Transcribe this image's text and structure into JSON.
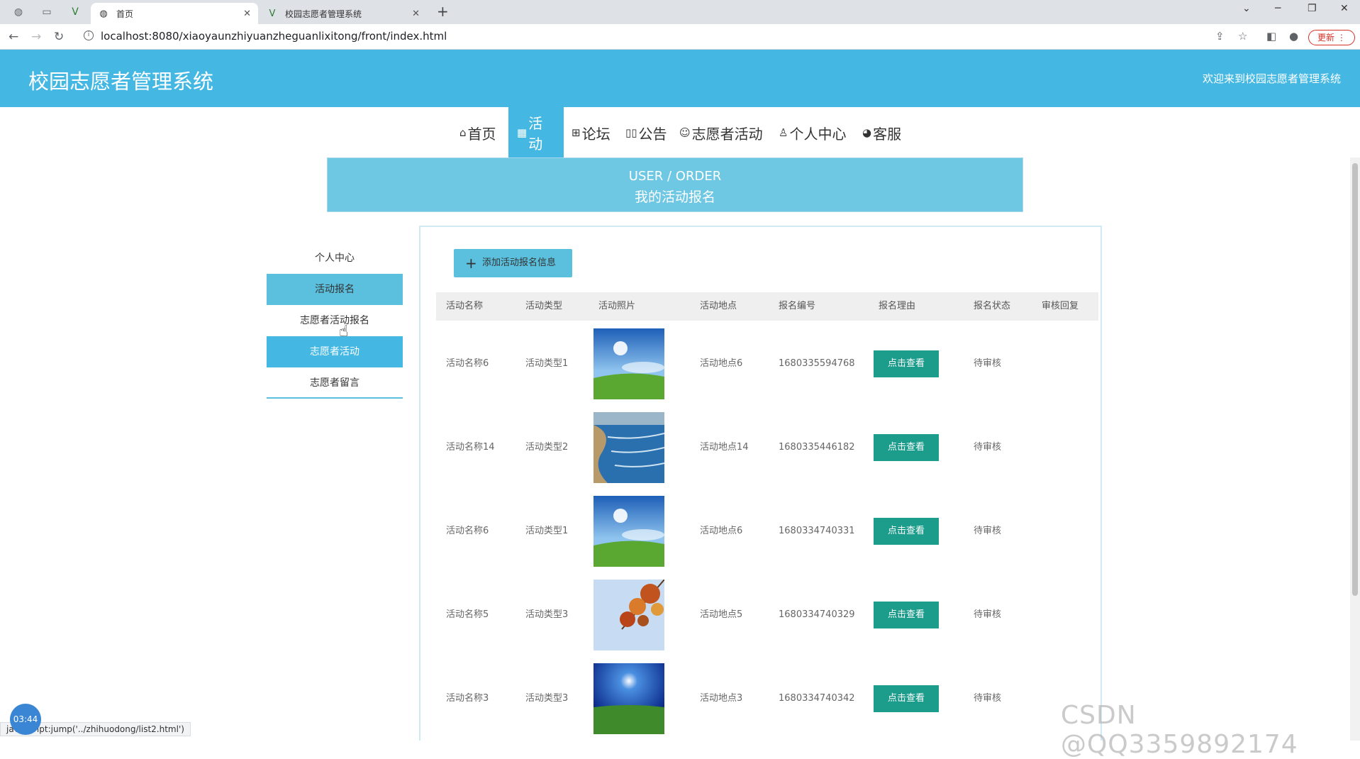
{
  "browser": {
    "tabs": [
      {
        "title": "首页",
        "active": true
      },
      {
        "title": "校园志愿者管理系统",
        "active": false
      }
    ],
    "url": "localhost:8080/xiaoyaunzhiyuanzheguanlixitong/front/index.html",
    "update_label": "更新",
    "status_text": "javascript:jump('../zhihuodong/list2.html')"
  },
  "header": {
    "title": "校园志愿者管理系统",
    "welcome": "欢迎来到校园志愿者管理系统"
  },
  "menu": [
    {
      "label": "首页",
      "icon": "home-icon"
    },
    {
      "label": "活动",
      "icon": "activity-icon"
    },
    {
      "label": "论坛",
      "icon": "forum-icon"
    },
    {
      "label": "公告",
      "icon": "notice-icon"
    },
    {
      "label": "志愿者活动",
      "icon": "volunteer-icon"
    },
    {
      "label": "个人中心",
      "icon": "user-icon"
    },
    {
      "label": "客服",
      "icon": "service-icon"
    }
  ],
  "banner": {
    "en": "USER / ORDER",
    "cn": "我的活动报名"
  },
  "sidebar": [
    {
      "label": "个人中心"
    },
    {
      "label": "活动报名"
    },
    {
      "label": "志愿者活动报名"
    },
    {
      "label": "志愿者活动"
    },
    {
      "label": "志愿者留言"
    }
  ],
  "add_button": "添加活动报名信息",
  "table": {
    "headers": [
      "活动名称",
      "活动类型",
      "活动照片",
      "活动地点",
      "报名编号",
      "报名理由",
      "报名状态",
      "审核回复"
    ],
    "view_label": "点击查看",
    "rows": [
      {
        "name": "活动名称6",
        "type": "活动类型1",
        "photo": "grass-sky",
        "place": "活动地点6",
        "code": "1680335594768",
        "status": "待审核"
      },
      {
        "name": "活动名称14",
        "type": "活动类型2",
        "photo": "coast",
        "place": "活动地点14",
        "code": "1680335446182",
        "status": "待审核"
      },
      {
        "name": "活动名称6",
        "type": "活动类型1",
        "photo": "grass-sky",
        "place": "活动地点6",
        "code": "1680334740331",
        "status": "待审核"
      },
      {
        "name": "活动名称5",
        "type": "活动类型3",
        "photo": "autumn-leaves",
        "place": "活动地点5",
        "code": "1680334740329",
        "status": "待审核"
      },
      {
        "name": "活动名称3",
        "type": "活动类型3",
        "photo": "night-field",
        "place": "活动地点3",
        "code": "1680334740342",
        "status": "待审核"
      }
    ]
  },
  "timer": "03:44",
  "watermark": "CSDN @QQ3359892174",
  "colors": {
    "primary": "#44b8e3",
    "light": "#5bc0de",
    "button": "#1c9d8c"
  }
}
